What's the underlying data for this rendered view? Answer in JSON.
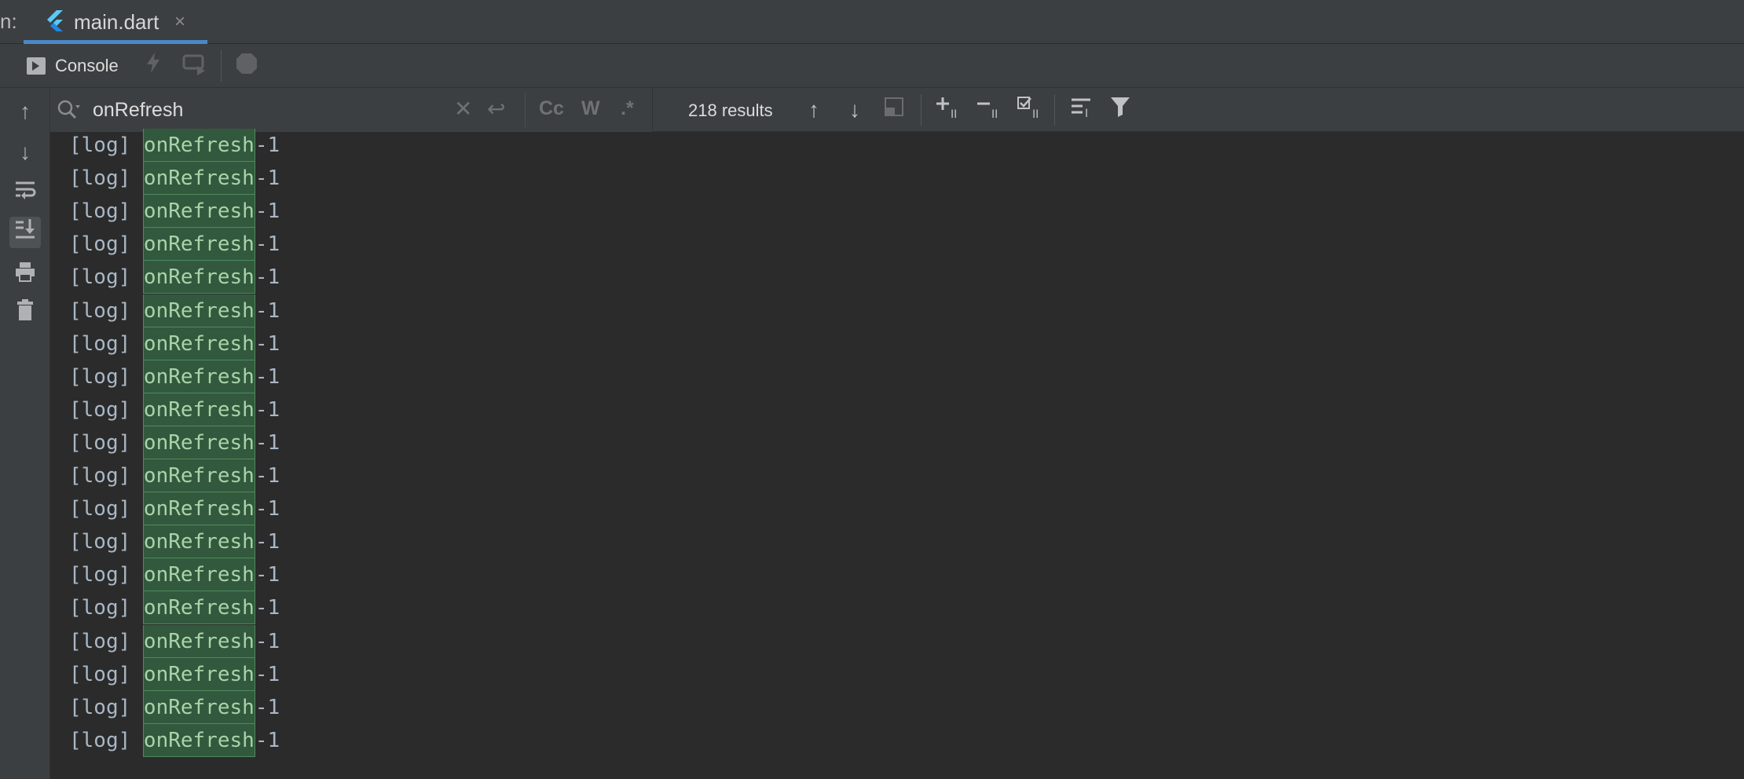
{
  "tabbar": {
    "run_label": "n:",
    "tab_label": "main.dart",
    "close_glyph": "×",
    "accent": "#4a88c7"
  },
  "console": {
    "label": "Console",
    "icons": [
      "console-icon",
      "lightning-icon",
      "rerun-icon",
      "stop-icon"
    ]
  },
  "gutter": {
    "icons": [
      "arrow-up-icon",
      "arrow-down-icon",
      "soft-wrap-icon",
      "scroll-to-end-icon",
      "print-icon",
      "trash-icon"
    ]
  },
  "search": {
    "value": "onRefresh",
    "placeholder": "",
    "match_case": "Cc",
    "words": "W",
    "regex": ".*",
    "results": "218 results"
  },
  "log": {
    "rows": [
      {
        "prefix": "[log] ",
        "match": "onRefresh",
        "suffix": "-1"
      },
      {
        "prefix": "[log] ",
        "match": "onRefresh",
        "suffix": "-1"
      },
      {
        "prefix": "[log] ",
        "match": "onRefresh",
        "suffix": "-1"
      },
      {
        "prefix": "[log] ",
        "match": "onRefresh",
        "suffix": "-1"
      },
      {
        "prefix": "[log] ",
        "match": "onRefresh",
        "suffix": "-1"
      },
      {
        "prefix": "[log] ",
        "match": "onRefresh",
        "suffix": "-1"
      },
      {
        "prefix": "[log] ",
        "match": "onRefresh",
        "suffix": "-1"
      },
      {
        "prefix": "[log] ",
        "match": "onRefresh",
        "suffix": "-1"
      },
      {
        "prefix": "[log] ",
        "match": "onRefresh",
        "suffix": "-1"
      },
      {
        "prefix": "[log] ",
        "match": "onRefresh",
        "suffix": "-1"
      },
      {
        "prefix": "[log] ",
        "match": "onRefresh",
        "suffix": "-1"
      },
      {
        "prefix": "[log] ",
        "match": "onRefresh",
        "suffix": "-1"
      },
      {
        "prefix": "[log] ",
        "match": "onRefresh",
        "suffix": "-1"
      },
      {
        "prefix": "[log] ",
        "match": "onRefresh",
        "suffix": "-1"
      },
      {
        "prefix": "[log] ",
        "match": "onRefresh",
        "suffix": "-1"
      },
      {
        "prefix": "[log] ",
        "match": "onRefresh",
        "suffix": "-1"
      },
      {
        "prefix": "[log] ",
        "match": "onRefresh",
        "suffix": "-1"
      },
      {
        "prefix": "[log] ",
        "match": "onRefresh",
        "suffix": "-1"
      },
      {
        "prefix": "[log] ",
        "match": "onRefresh",
        "suffix": "-1"
      }
    ]
  },
  "colors": {
    "background": "#2b2b2b",
    "panel": "#3c3f41",
    "match_bg": "#32593d",
    "text": "#a9b7c6"
  }
}
